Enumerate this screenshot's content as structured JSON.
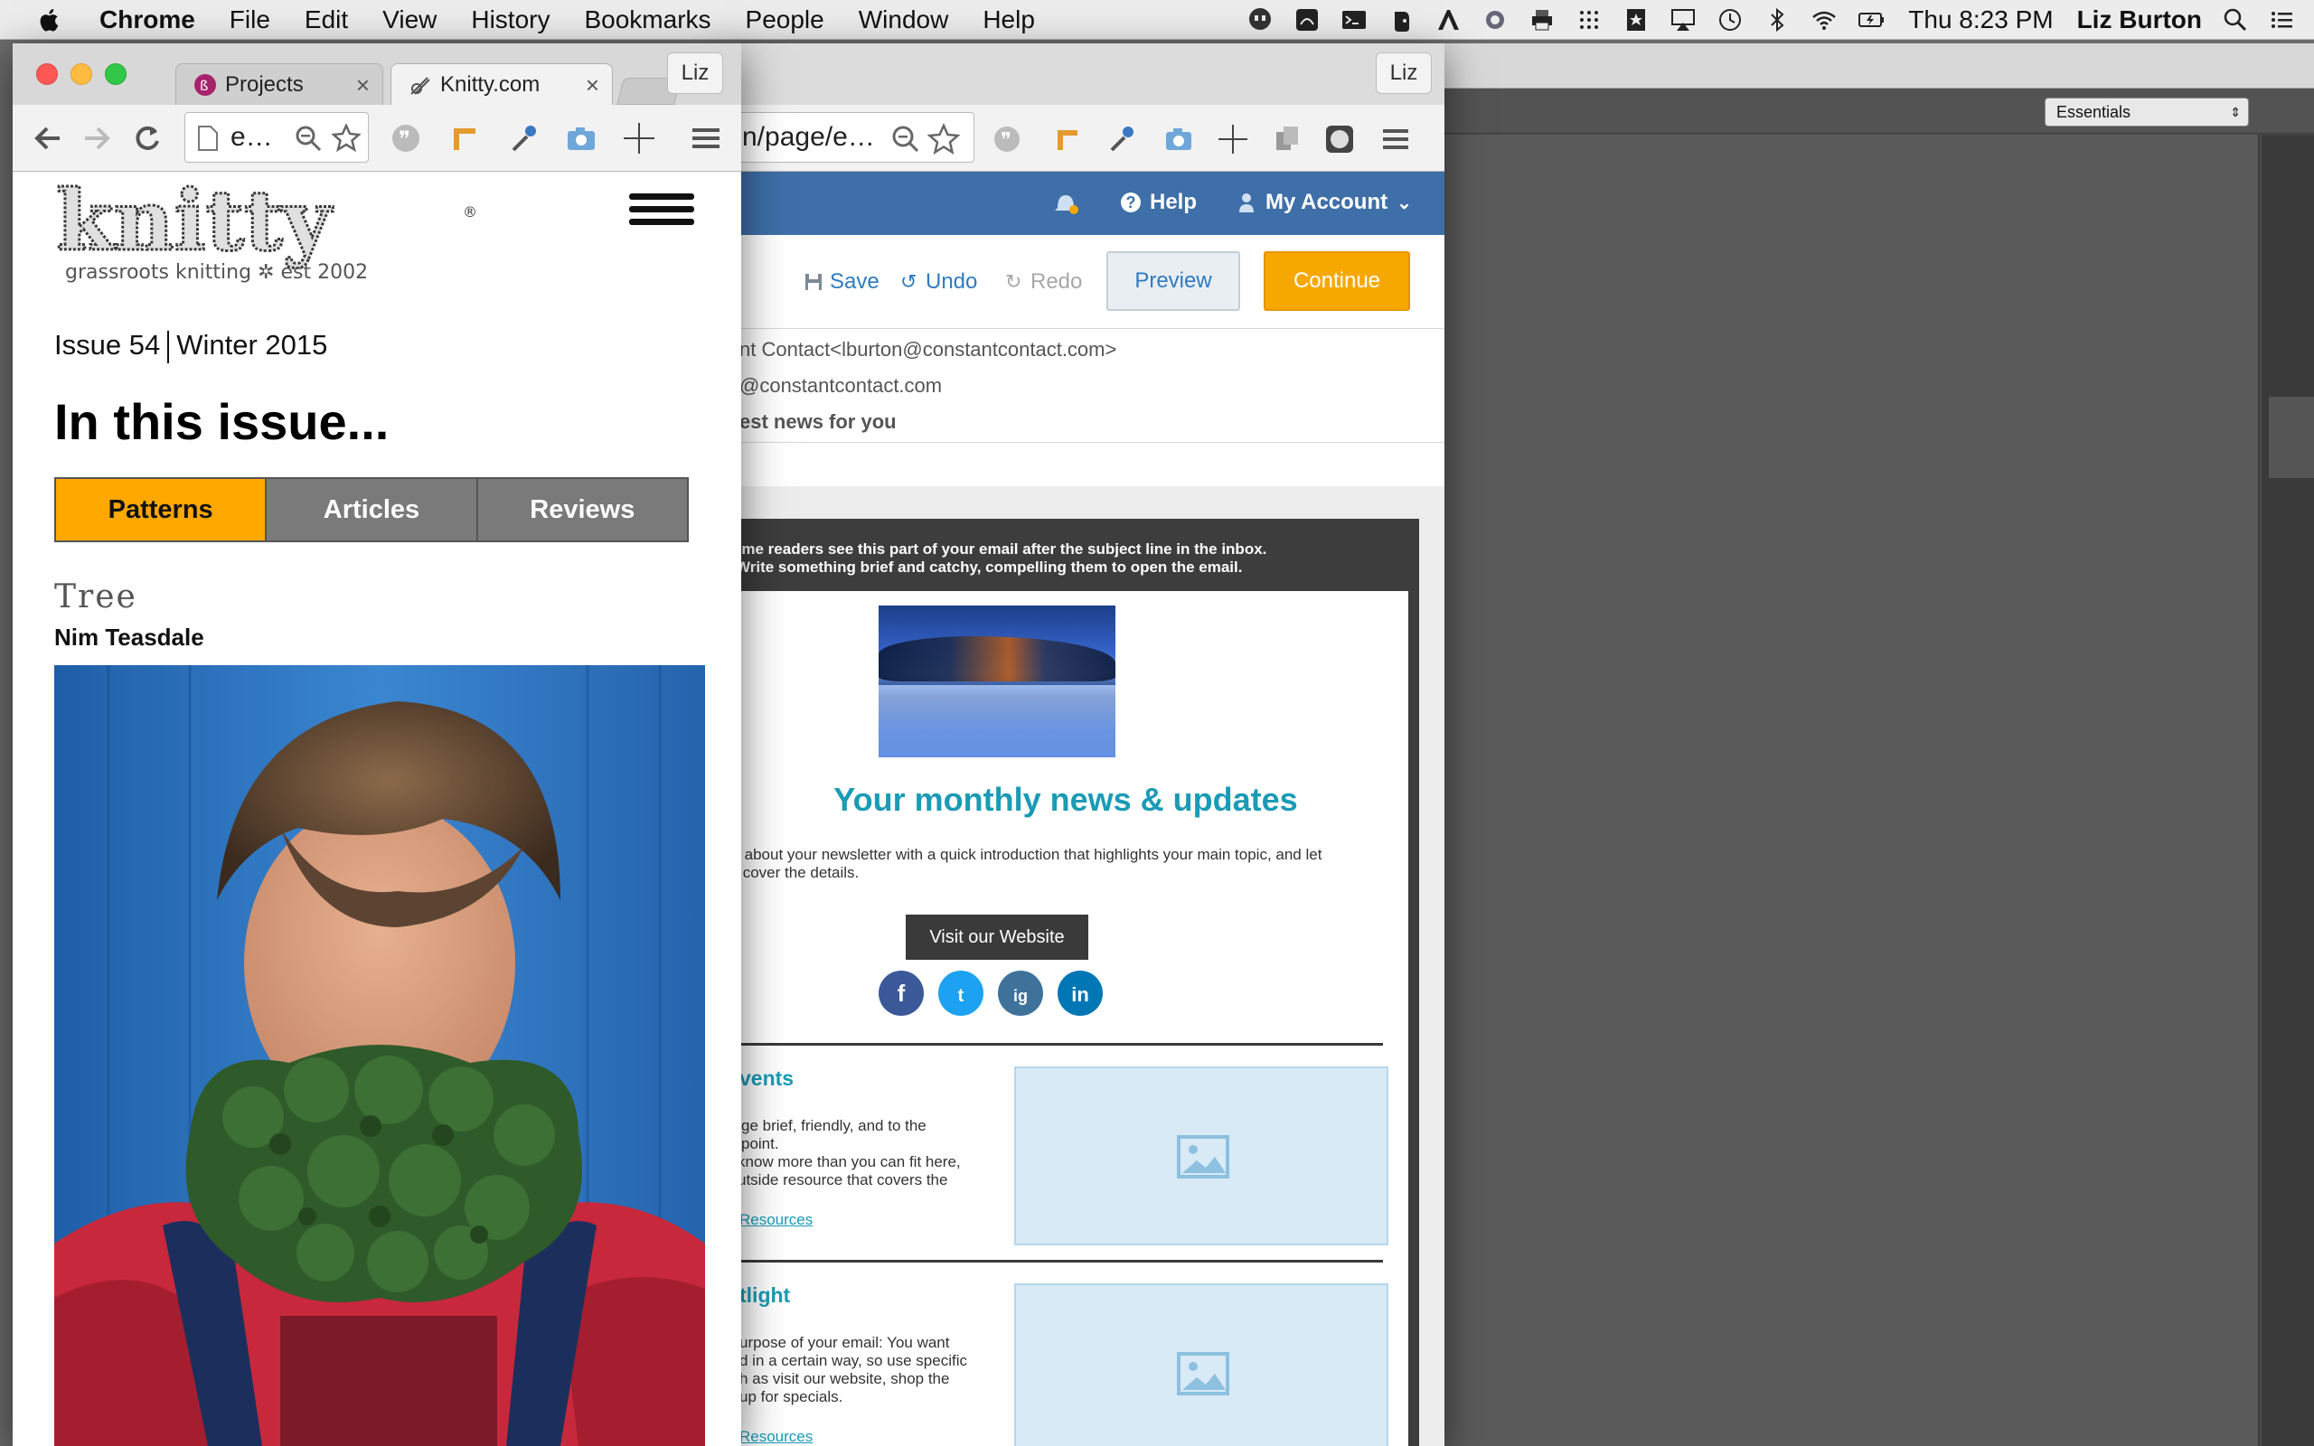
{
  "menubar": {
    "app": "Chrome",
    "items": [
      "File",
      "Edit",
      "View",
      "History",
      "Bookmarks",
      "People",
      "Window",
      "Help"
    ],
    "datetime": "Thu 8:23 PM",
    "user": "Liz Burton"
  },
  "bg_app": {
    "workspace": "Essentials"
  },
  "win1": {
    "tabs": [
      {
        "label": "Projects"
      },
      {
        "label": "Knitty.com"
      }
    ],
    "profile": "Liz",
    "omnibox": "e…",
    "page": {
      "logo_text": "knitty",
      "logo_tagline": "grassroots knitting ✲ est 2002",
      "issue_number": "Issue 54",
      "issue_season": "Winter 2015",
      "heading": "In this issue...",
      "tabs": [
        "Patterns",
        "Articles",
        "Reviews"
      ],
      "pattern_title": "Tree",
      "pattern_author": "Nim Teasdale"
    }
  },
  "win2": {
    "profile": "Liz",
    "omnibox": "n/page/e…",
    "header": {
      "help": "Help",
      "account": "My Account"
    },
    "actions": {
      "save": "Save",
      "undo": "Undo",
      "redo": "Redo",
      "preview": "Preview",
      "continue": "Continue"
    },
    "meta": {
      "from": "nt Contact<lburton@constantcontact.com>",
      "reply": "@constantcontact.com",
      "subject": "est news for you"
    },
    "email": {
      "preheader_1": "ome readers see this part of your email after the subject line in the inbox.",
      "preheader_2": "Write something brief and catchy, compelling them to open the email.",
      "title": "Your monthly news & updates",
      "intro_1": "ed about your newsletter with a quick introduction that highlights your main topic, and let",
      "intro_2": "ail cover the details.",
      "button": "Visit our Website",
      "social": [
        "f",
        "t",
        "ig",
        "in"
      ],
      "block1": {
        "title": "vents",
        "p1": "ge brief, friendly, and to the point.",
        "p2": "know more than you can fit here,",
        "p3": "utside resource that covers the",
        "link": "Resources"
      },
      "block2": {
        "title": "tlight",
        "p1": "urpose of your email: You want",
        "p2": "d in a certain way, so use specific",
        "p3": "h as visit our website, shop the",
        "p4": "up for specials.",
        "link": "Resources"
      }
    }
  }
}
